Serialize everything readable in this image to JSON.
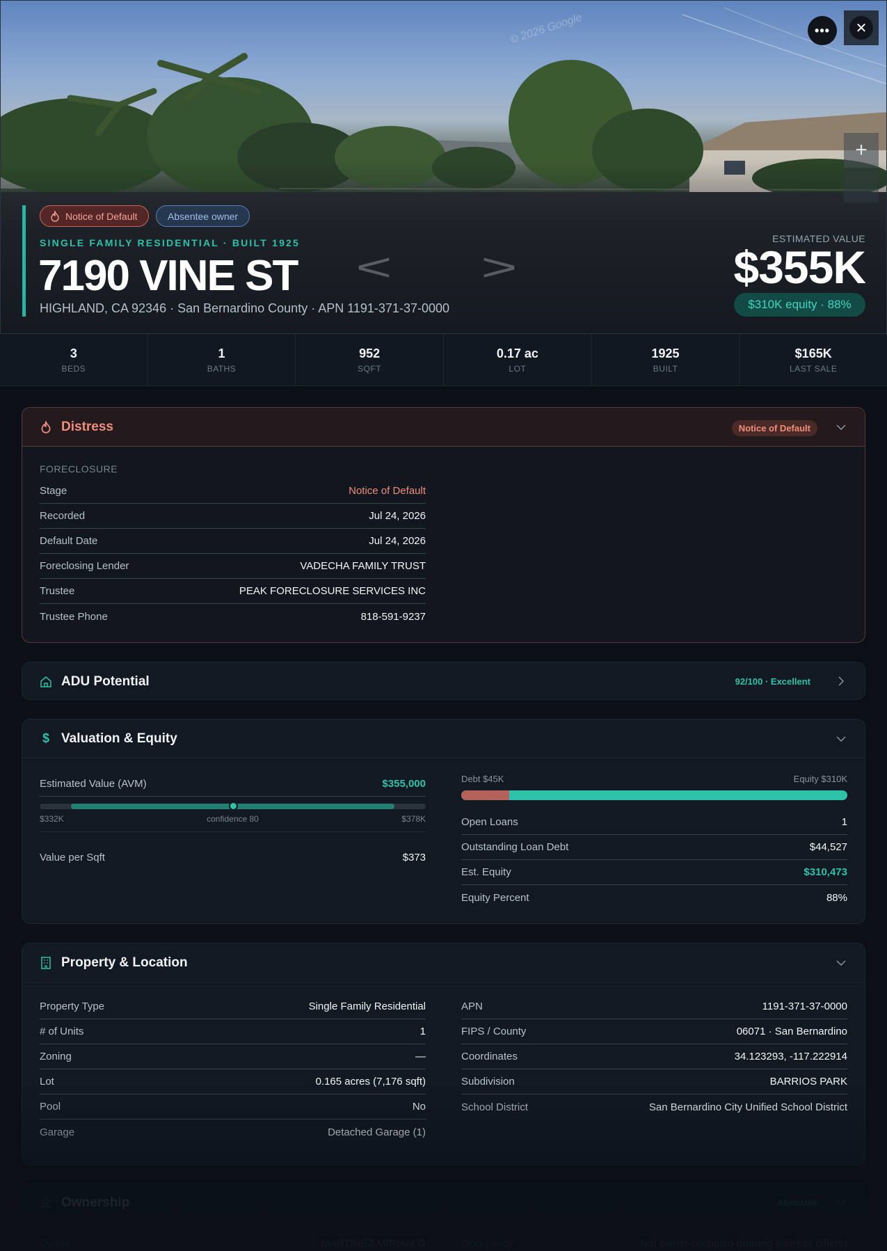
{
  "hero": {
    "watermark": "© 2026 Google",
    "chips": {
      "distress": "Notice of Default",
      "owner": "Absentee owner"
    },
    "kicker": "SINGLE FAMILY RESIDENTIAL · BUILT 1925",
    "address": "7190 VINE ST",
    "subaddress": "HIGHLAND, CA 92346 · San Bernardino County · APN 1191-371-37-0000",
    "estimated_value_label": "ESTIMATED VALUE",
    "estimated_value": "$355K",
    "equity_pill": "$310K equity · 88%"
  },
  "stats": [
    {
      "value": "3",
      "label": "BEDS"
    },
    {
      "value": "1",
      "label": "BATHS"
    },
    {
      "value": "952",
      "label": "SQFT"
    },
    {
      "value": "0.17 ac",
      "label": "LOT"
    },
    {
      "value": "1925",
      "label": "BUILT"
    },
    {
      "value": "$165K",
      "label": "LAST SALE"
    }
  ],
  "distress": {
    "title": "Distress",
    "badge": "Notice of Default",
    "section_label": "FORECLOSURE",
    "rows": [
      {
        "k": "Stage",
        "v": "Notice of Default"
      },
      {
        "k": "Recorded",
        "v": "Jul 24, 2026"
      },
      {
        "k": "Default Date",
        "v": "Jul 24, 2026"
      },
      {
        "k": "Foreclosing Lender",
        "v": "VADECHA FAMILY TRUST"
      },
      {
        "k": "Trustee",
        "v": "PEAK FORECLOSURE SERVICES INC"
      },
      {
        "k": "Trustee Phone",
        "v": "818-591-9237"
      }
    ]
  },
  "adu": {
    "title": "ADU Potential",
    "badge": "92/100 · Excellent"
  },
  "valuation": {
    "title": "Valuation & Equity",
    "avm_label": "Estimated Value (AVM)",
    "avm_value": "$355,000",
    "range_low": "$332K",
    "range_high": "$378K",
    "confidence_label": "confidence 80",
    "confidence_position": 0.5,
    "vps_label": "Value per Sqft",
    "vps_value": "$373",
    "debt_label": "Debt $45K",
    "equity_label": "Equity $310K",
    "debt_fraction": 0.125,
    "rows": [
      {
        "k": "Open Loans",
        "v": "1"
      },
      {
        "k": "Outstanding Loan Debt",
        "v": "$44,527"
      },
      {
        "k": "Est. Equity",
        "v": "$310,473"
      },
      {
        "k": "Equity Percent",
        "v": "88%"
      }
    ]
  },
  "property": {
    "title": "Property & Location",
    "left": [
      {
        "k": "Property Type",
        "v": "Single Family Residential"
      },
      {
        "k": "# of Units",
        "v": "1"
      },
      {
        "k": "Zoning",
        "v": "—"
      },
      {
        "k": "Lot",
        "v": "0.165 acres (7,176 sqft)"
      },
      {
        "k": "Pool",
        "v": "No"
      },
      {
        "k": "Garage",
        "v": "Detached Garage (1)"
      }
    ],
    "right": [
      {
        "k": "APN",
        "v": "1191-371-37-0000"
      },
      {
        "k": "FIPS / County",
        "v": "06071 · San Bernardino"
      },
      {
        "k": "Coordinates",
        "v": "34.123293, -117.222914"
      },
      {
        "k": "Subdivision",
        "v": "BARRIOS PARK"
      },
      {
        "k": "School District",
        "v": "San Bernardino City Unified School District"
      }
    ]
  },
  "ownership": {
    "title": "Ownership",
    "badge": "Absentee",
    "row_owner": {
      "k": "Owner",
      "v": "MARTINEZ MIRIAM G"
    },
    "row_occupancy": {
      "k": "Occupancy",
      "v": "Not owner-occupied (mailing address differs)"
    }
  },
  "colors": {
    "accent": "#2ec2aa",
    "distress": "#f08d7c",
    "background": "#0b1018"
  }
}
